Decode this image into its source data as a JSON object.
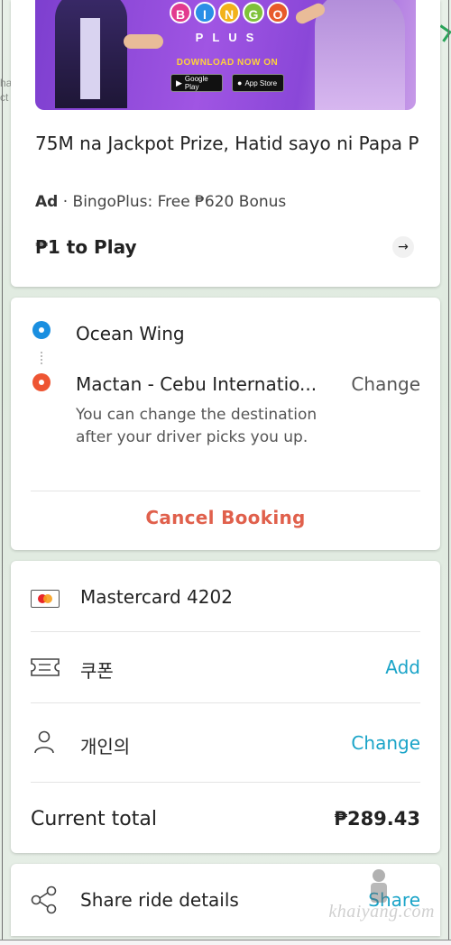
{
  "map": {
    "edge_text": "ha ct"
  },
  "ad": {
    "banner": {
      "logo_letters": [
        "B",
        "I",
        "N",
        "G",
        "O"
      ],
      "logo_colors": [
        "#e23a8f",
        "#2a8fe6",
        "#f2b21b",
        "#7fc23a",
        "#e85a2a"
      ],
      "logo_sub": "PLUS",
      "download_text": "DOWNLOAD NOW ON",
      "google_play": "Google Play",
      "app_store": "App Store"
    },
    "title": "75M na Jackpot Prize, Hatid sayo ni Papa P",
    "ad_label": "Ad",
    "source": " · BingoPlus: Free ₱620 Bonus",
    "cta": "₱1 to Play",
    "arrow_icon": "arrow-right-icon"
  },
  "route": {
    "pickup": "Ocean Wing",
    "destination": "Mactan - Cebu Internatio...",
    "change_label": "Change",
    "note": "You can change the destination after your driver picks you up.",
    "cancel_label": "Cancel Booking",
    "colors": {
      "pickup": "#1a8fe0",
      "destination": "#ee5533",
      "cancel": "#e0604c"
    }
  },
  "payment": {
    "card_label": "Mastercard 4202",
    "coupon_label": "쿠폰",
    "coupon_action": "Add",
    "profile_label": "개인의",
    "profile_action": "Change",
    "total_label": "Current total",
    "total_value": "₱289.43",
    "accent": "#1aa4c8"
  },
  "share": {
    "label": "Share ride details",
    "action": "Share"
  },
  "watermark": "khaiyang.com"
}
